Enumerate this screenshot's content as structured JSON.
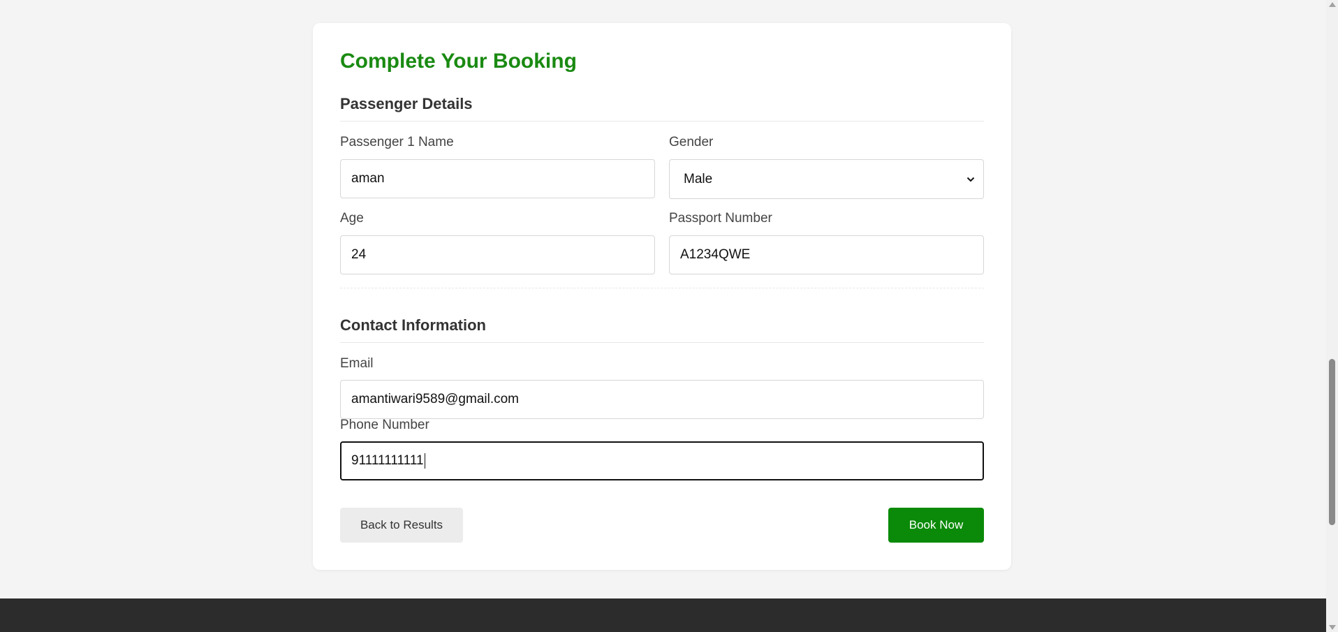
{
  "form": {
    "title": "Complete Your Booking",
    "passenger_section": {
      "heading": "Passenger Details",
      "name_label": "Passenger 1 Name",
      "name_value": "aman",
      "gender_label": "Gender",
      "gender_value": "Male",
      "age_label": "Age",
      "age_value": "24",
      "passport_label": "Passport Number",
      "passport_value": "A1234QWE"
    },
    "contact_section": {
      "heading": "Contact Information",
      "email_label": "Email",
      "email_value": "amantiwari9589@gmail.com",
      "phone_label": "Phone Number",
      "phone_value": "91111111111"
    },
    "actions": {
      "back_label": "Back to Results",
      "book_label": "Book Now"
    }
  },
  "icons": {
    "select_arrow": "chevron-down-icon",
    "cursor_marker": "pointer-marker-icon"
  },
  "colors": {
    "title_green": "#1a8a12",
    "primary_button": "#0a8a08",
    "marker_magenta": "#d24ee8",
    "footer": "#2c2c2c"
  }
}
